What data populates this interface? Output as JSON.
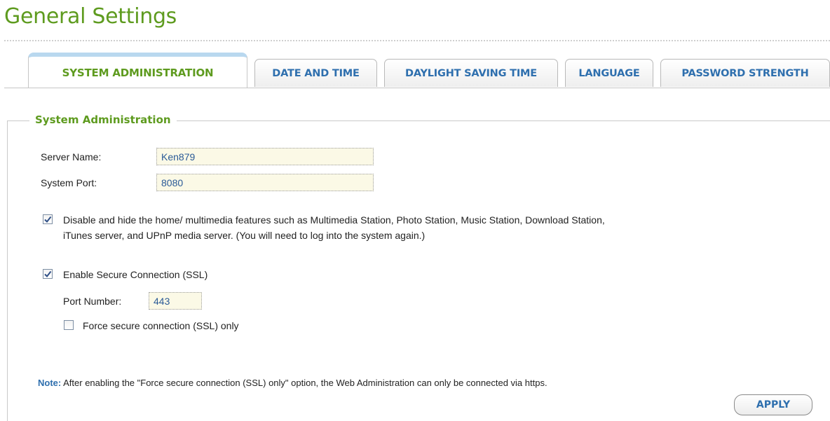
{
  "page": {
    "title": "General Settings"
  },
  "tabs": [
    {
      "label": "SYSTEM ADMINISTRATION",
      "active": true
    },
    {
      "label": "DATE AND TIME",
      "active": false
    },
    {
      "label": "DAYLIGHT SAVING TIME",
      "active": false
    },
    {
      "label": "LANGUAGE",
      "active": false
    },
    {
      "label": "PASSWORD STRENGTH",
      "active": false
    }
  ],
  "section": {
    "legend": "System Administration",
    "server_name": {
      "label": "Server Name:",
      "value": "Ken879"
    },
    "system_port": {
      "label": "System Port:",
      "value": "8080"
    },
    "disable_multimedia": {
      "checked": true,
      "text_line1": "Disable and hide the home/ multimedia features such as Multimedia Station, Photo Station, Music Station, Download Station,",
      "text_line2": "iTunes server, and UPnP media server. (You will need to log into the system again.)"
    },
    "ssl": {
      "checked": true,
      "label": "Enable Secure Connection (SSL)",
      "port_label": "Port Number:",
      "port_value": "443",
      "force": {
        "checked": false,
        "label": "Force secure connection (SSL) only"
      }
    },
    "note": {
      "prefix": "Note:",
      "text": "After enabling the \"Force secure connection (SSL) only\" option, the Web Administration can only be connected via https."
    }
  },
  "buttons": {
    "apply_label": "APPLY"
  },
  "colors": {
    "brand_green": "#5e9b1f",
    "link_blue": "#2e6fae",
    "input_bg": "#fbf9e6"
  }
}
